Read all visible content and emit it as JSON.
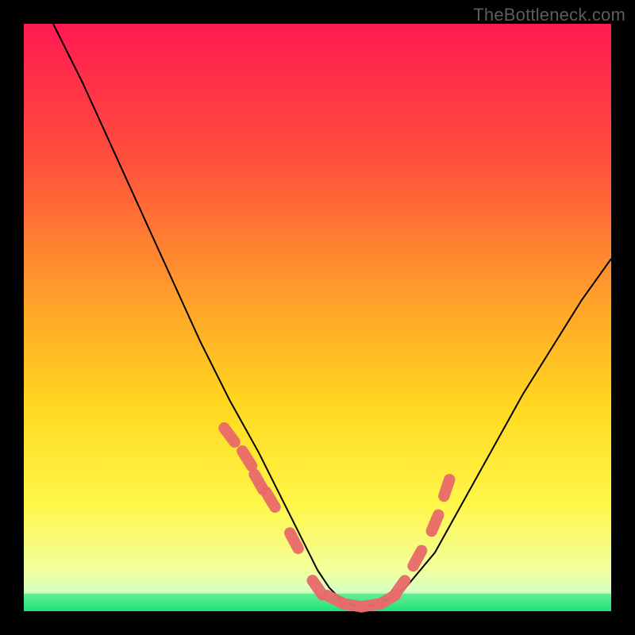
{
  "watermark": "TheBottleneck.com",
  "chart_data": {
    "type": "line",
    "title": "",
    "xlabel": "",
    "ylabel": "",
    "xlim": [
      0,
      100
    ],
    "ylim": [
      0,
      100
    ],
    "grid": false,
    "legend": false,
    "background": {
      "type": "vertical_gradient",
      "stops": [
        {
          "pos": 0.0,
          "color": "#ff1a52"
        },
        {
          "pos": 0.22,
          "color": "#ff4c3d"
        },
        {
          "pos": 0.45,
          "color": "#ff9a2b"
        },
        {
          "pos": 0.65,
          "color": "#ffd81f"
        },
        {
          "pos": 0.82,
          "color": "#fff74a"
        },
        {
          "pos": 0.93,
          "color": "#f3ff9d"
        },
        {
          "pos": 0.965,
          "color": "#d8ffc2"
        },
        {
          "pos": 1.0,
          "color": "#22e07a"
        }
      ]
    },
    "frame_color": "#000000",
    "frame_thickness_px": 30,
    "series": [
      {
        "name": "bottleneck_curve",
        "stroke": "#000000",
        "stroke_width": 2,
        "x": [
          5,
          10,
          15,
          20,
          25,
          30,
          35,
          40,
          45,
          48,
          50,
          52,
          54,
          56,
          58,
          60,
          62,
          65,
          70,
          75,
          80,
          85,
          90,
          95,
          100
        ],
        "y": [
          100,
          90,
          79,
          68,
          57,
          46,
          36,
          27,
          17,
          11,
          7,
          4,
          2,
          1,
          1,
          1,
          2,
          4,
          10,
          19,
          28,
          37,
          45,
          53,
          60
        ]
      },
      {
        "name": "optimal_band_markers",
        "stroke": "none",
        "marker_color": "#e96a6a",
        "marker_radius": 9,
        "x": [
          35,
          38,
          40,
          42,
          46,
          50,
          53,
          56,
          59,
          62,
          64,
          67,
          70,
          72
        ],
        "y": [
          30,
          26,
          22,
          19,
          12,
          4,
          2,
          1,
          1,
          2,
          4,
          9,
          15,
          21
        ]
      }
    ],
    "green_strip": {
      "y_from": 0,
      "y_to": 3
    }
  }
}
